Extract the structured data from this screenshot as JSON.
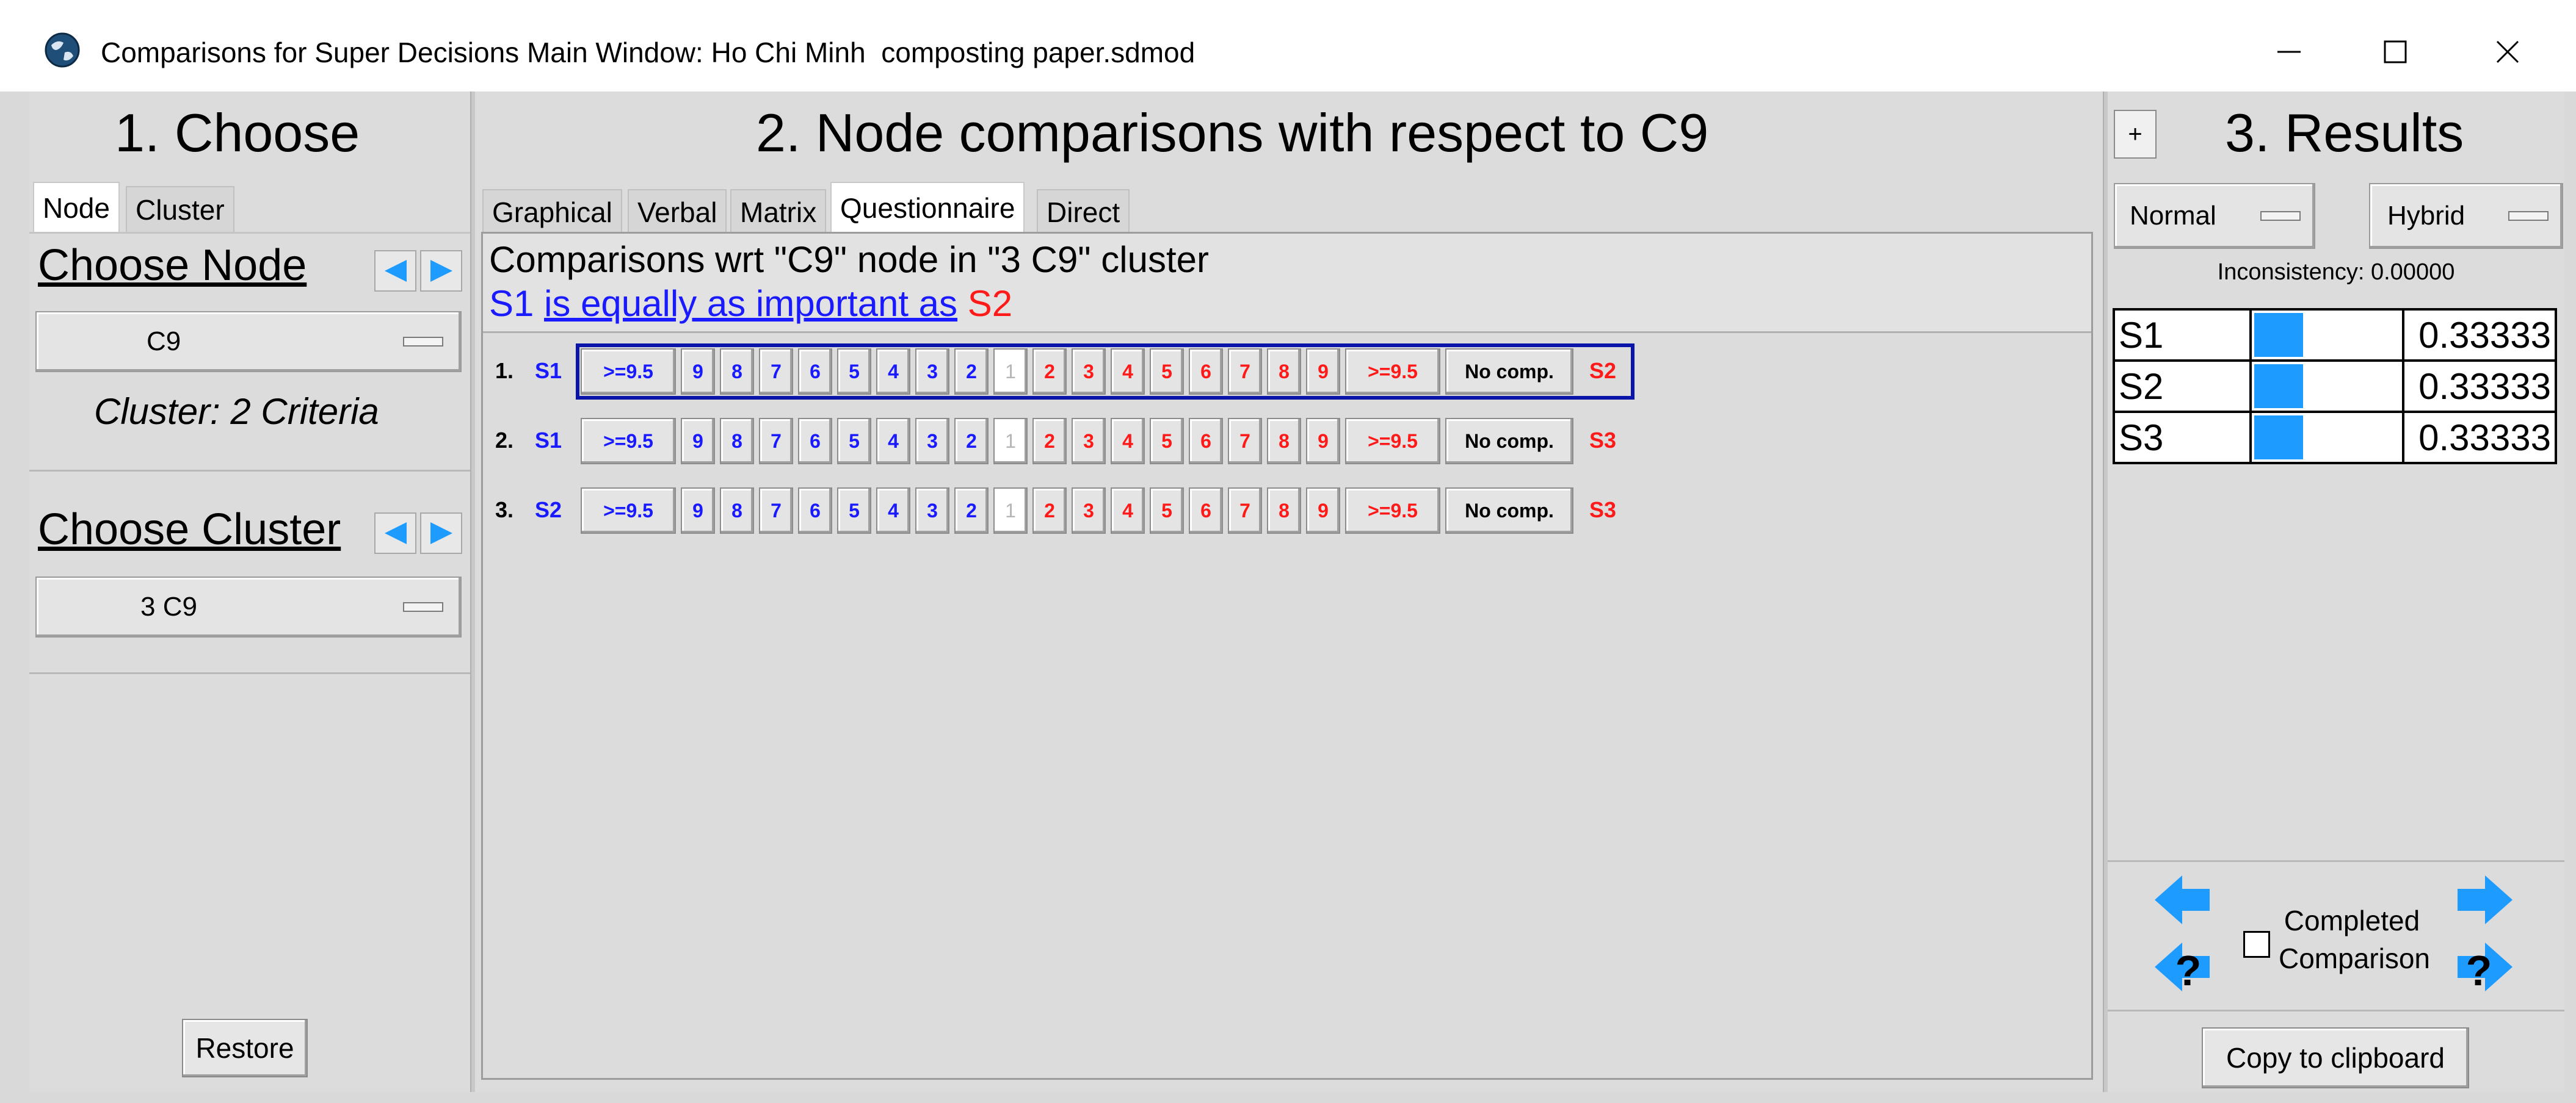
{
  "window": {
    "title": "Comparisons for Super Decisions Main Window: Ho Chi Minh  composting paper.sdmod",
    "minimize_icon": "minimize-icon",
    "maximize_icon": "maximize-icon",
    "close_icon": "close-icon"
  },
  "left": {
    "section_title": "1. Choose",
    "tabs": [
      {
        "label": "Node",
        "active": true
      },
      {
        "label": "Cluster",
        "active": false
      }
    ],
    "choose_node_label": "Choose Node",
    "node_value": "C9",
    "cluster_info": "Cluster: 2 Criteria",
    "choose_cluster_label": "Choose Cluster",
    "cluster_value": "3 C9",
    "restore_label": "Restore"
  },
  "middle": {
    "section_title": "2. Node comparisons with respect to C9",
    "tabs": [
      {
        "label": "Graphical",
        "active": false
      },
      {
        "label": "Verbal",
        "active": false
      },
      {
        "label": "Matrix",
        "active": false
      },
      {
        "label": "Questionnaire",
        "active": true
      },
      {
        "label": "Direct",
        "active": false
      }
    ],
    "wrt_text": "Comparisons wrt \"C9\" node in \"3 C9\" cluster",
    "verbal": {
      "left": "S1",
      "phrase": "is equally as important as",
      "right": "S2"
    },
    "scale_left": [
      ">=9.5",
      "9",
      "8",
      "7",
      "6",
      "5",
      "4",
      "3",
      "2"
    ],
    "scale_equal": "1",
    "scale_right": [
      "2",
      "3",
      "4",
      "5",
      "6",
      "7",
      "8",
      "9",
      ">=9.5"
    ],
    "no_comp_label": "No comp.",
    "rows": [
      {
        "num": "1.",
        "left": "S1",
        "right": "S2",
        "selected": true
      },
      {
        "num": "2.",
        "left": "S1",
        "right": "S3",
        "selected": false
      },
      {
        "num": "3.",
        "left": "S2",
        "right": "S3",
        "selected": false
      }
    ]
  },
  "right": {
    "plus_label": "+",
    "section_title": "3. Results",
    "normal_label": "Normal",
    "hybrid_label": "Hybrid",
    "inconsistency": "Inconsistency: 0.00000",
    "results": [
      {
        "name": "S1",
        "value": "0.33333",
        "weight": 0.33333
      },
      {
        "name": "S2",
        "value": "0.33333",
        "weight": 0.33333
      },
      {
        "name": "S3",
        "value": "0.33333",
        "weight": 0.33333
      }
    ],
    "completed_label": "Completed Comparison",
    "completed_checked": false,
    "copy_label": "Copy to clipboard",
    "bar_color": "#1e9bff"
  }
}
